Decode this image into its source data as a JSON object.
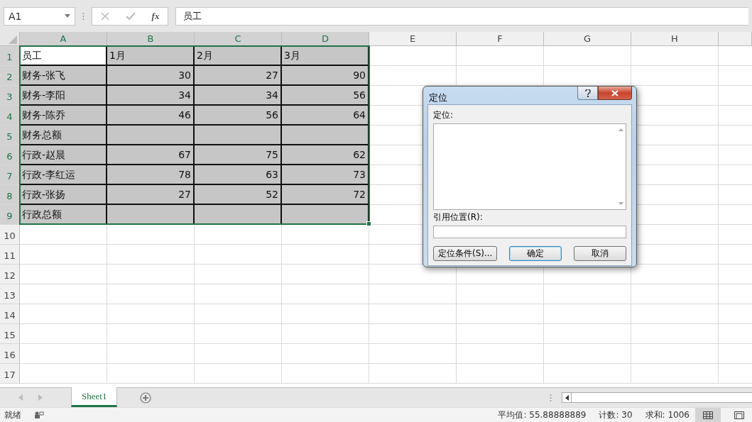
{
  "name_box": {
    "value": "A1"
  },
  "formula_bar": {
    "function_label": "fx",
    "value": "员工"
  },
  "columns": [
    {
      "label": "A",
      "selected": true
    },
    {
      "label": "B",
      "selected": true
    },
    {
      "label": "C",
      "selected": true
    },
    {
      "label": "D",
      "selected": true
    },
    {
      "label": "E",
      "selected": false
    },
    {
      "label": "F",
      "selected": false
    },
    {
      "label": "G",
      "selected": false
    },
    {
      "label": "H",
      "selected": false
    }
  ],
  "rows": [
    {
      "number": "1",
      "selected": true,
      "cells": [
        {
          "value": "员工",
          "kind": "text",
          "selected": true,
          "active": true
        },
        {
          "value": "1月",
          "kind": "text",
          "selected": true,
          "active": false
        },
        {
          "value": "2月",
          "kind": "text",
          "selected": true,
          "active": false
        },
        {
          "value": "3月",
          "kind": "text",
          "selected": true,
          "active": false
        }
      ]
    },
    {
      "number": "2",
      "selected": true,
      "cells": [
        {
          "value": "财务-张飞",
          "kind": "text",
          "selected": true,
          "active": false
        },
        {
          "value": "30",
          "kind": "number",
          "selected": true,
          "active": false
        },
        {
          "value": "27",
          "kind": "number",
          "selected": true,
          "active": false
        },
        {
          "value": "90",
          "kind": "number",
          "selected": true,
          "active": false
        }
      ]
    },
    {
      "number": "3",
      "selected": true,
      "cells": [
        {
          "value": "财务-李阳",
          "kind": "text",
          "selected": true,
          "active": false
        },
        {
          "value": "34",
          "kind": "number",
          "selected": true,
          "active": false
        },
        {
          "value": "34",
          "kind": "number",
          "selected": true,
          "active": false
        },
        {
          "value": "56",
          "kind": "number",
          "selected": true,
          "active": false
        }
      ]
    },
    {
      "number": "4",
      "selected": true,
      "cells": [
        {
          "value": "财务-陈乔",
          "kind": "text",
          "selected": true,
          "active": false
        },
        {
          "value": "46",
          "kind": "number",
          "selected": true,
          "active": false
        },
        {
          "value": "56",
          "kind": "number",
          "selected": true,
          "active": false
        },
        {
          "value": "64",
          "kind": "number",
          "selected": true,
          "active": false
        }
      ]
    },
    {
      "number": "5",
      "selected": true,
      "cells": [
        {
          "value": "财务总额",
          "kind": "text",
          "selected": true,
          "active": false
        },
        {
          "kind": "empty",
          "selected": true,
          "active": false
        },
        {
          "kind": "empty",
          "selected": true,
          "active": false
        },
        {
          "kind": "empty",
          "selected": true,
          "active": false
        }
      ]
    },
    {
      "number": "6",
      "selected": true,
      "cells": [
        {
          "value": "行政-赵晨",
          "kind": "text",
          "selected": true,
          "active": false
        },
        {
          "value": "67",
          "kind": "number",
          "selected": true,
          "active": false
        },
        {
          "value": "75",
          "kind": "number",
          "selected": true,
          "active": false
        },
        {
          "value": "62",
          "kind": "number",
          "selected": true,
          "active": false
        }
      ]
    },
    {
      "number": "7",
      "selected": true,
      "cells": [
        {
          "value": "行政-李红运",
          "kind": "text",
          "selected": true,
          "active": false
        },
        {
          "value": "78",
          "kind": "number",
          "selected": true,
          "active": false
        },
        {
          "value": "63",
          "kind": "number",
          "selected": true,
          "active": false
        },
        {
          "value": "73",
          "kind": "number",
          "selected": true,
          "active": false
        }
      ]
    },
    {
      "number": "8",
      "selected": true,
      "cells": [
        {
          "value": "行政-张扬",
          "kind": "text",
          "selected": true,
          "active": false
        },
        {
          "value": "27",
          "kind": "number",
          "selected": true,
          "active": false
        },
        {
          "value": "52",
          "kind": "number",
          "selected": true,
          "active": false
        },
        {
          "value": "72",
          "kind": "number",
          "selected": true,
          "active": false
        }
      ]
    },
    {
      "number": "9",
      "selected": true,
      "cells": [
        {
          "value": "行政总额",
          "kind": "text",
          "selected": true,
          "active": false
        },
        {
          "kind": "empty",
          "selected": true,
          "active": false
        },
        {
          "kind": "empty",
          "selected": true,
          "active": false
        },
        {
          "kind": "empty",
          "selected": true,
          "active": false
        }
      ]
    },
    {
      "number": "10",
      "selected": false,
      "cells": []
    },
    {
      "number": "11",
      "selected": false,
      "cells": []
    },
    {
      "number": "12",
      "selected": false,
      "cells": []
    },
    {
      "number": "13",
      "selected": false,
      "cells": []
    },
    {
      "number": "14",
      "selected": false,
      "cells": []
    },
    {
      "number": "15",
      "selected": false,
      "cells": []
    },
    {
      "number": "16",
      "selected": false,
      "cells": []
    },
    {
      "number": "17",
      "selected": false,
      "cells": []
    }
  ],
  "sheet_tabs": [
    {
      "label": "Sheet1",
      "selected": true
    }
  ],
  "status_bar": {
    "mode": "就绪",
    "average": "平均值: 55.88888889",
    "count": "计数: 30",
    "sum": "求和: 1006"
  },
  "dialog": {
    "title": "定位",
    "list_label": "定位:",
    "reference_label": "引用位置(R):",
    "buttons": [
      {
        "label": "定位条件(S)...",
        "default": false
      },
      {
        "label": "确定",
        "default": true
      },
      {
        "label": "取消",
        "default": false
      }
    ]
  }
}
